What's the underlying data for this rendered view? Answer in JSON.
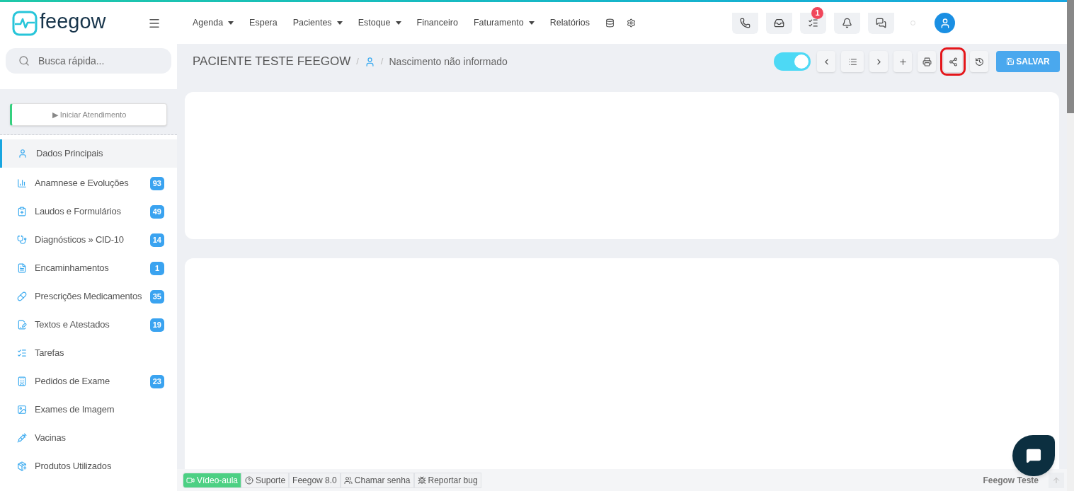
{
  "logo": {
    "text": "feegow"
  },
  "nav": [
    {
      "label": "Agenda",
      "dropdown": true
    },
    {
      "label": "Espera",
      "dropdown": false
    },
    {
      "label": "Pacientes",
      "dropdown": true
    },
    {
      "label": "Estoque",
      "dropdown": true
    },
    {
      "label": "Financeiro",
      "dropdown": false
    },
    {
      "label": "Faturamento",
      "dropdown": true
    },
    {
      "label": "Relatórios",
      "dropdown": false
    }
  ],
  "header_buttons": [
    {
      "kind": "phone"
    },
    {
      "kind": "inbox"
    },
    {
      "kind": "tasks",
      "badge": "1"
    },
    {
      "kind": "bell"
    },
    {
      "kind": "chat"
    }
  ],
  "search": {
    "placeholder": "Busca rápida..."
  },
  "start_button": {
    "label": "▶ Iniciar Atendimento"
  },
  "sidebar": {
    "items": [
      {
        "label": "Dados Principais",
        "selected": true
      },
      {
        "label": "Anamnese e Evoluções",
        "badge": "93",
        "selected": false
      },
      {
        "label": "Laudos e Formulários",
        "badge": "49",
        "selected": false
      },
      {
        "label": "Diagnósticos » CID-10",
        "badge": "14",
        "selected": false
      },
      {
        "label": "Encaminhamentos",
        "badge": "1",
        "selected": false
      },
      {
        "label": "Prescrições Medicamentos",
        "badge": "35",
        "selected": false
      },
      {
        "label": "Textos e Atestados",
        "badge": "19",
        "selected": false
      },
      {
        "label": "Tarefas",
        "selected": false
      },
      {
        "label": "Pedidos de Exame",
        "badge": "23",
        "selected": false
      },
      {
        "label": "Exames de Imagem",
        "selected": false
      },
      {
        "label": "Vacinas",
        "selected": false
      },
      {
        "label": "Produtos Utilizados",
        "selected": false
      }
    ]
  },
  "patient": {
    "name": "PACIENTE TESTE FEEGOW",
    "separators": [
      "/",
      "/"
    ],
    "birth": "Nascimento não informado"
  },
  "toolbar": {
    "toggle_on": true,
    "buttons": [
      {
        "kind": "prev",
        "highlighted": false
      },
      {
        "kind": "list",
        "highlighted": false
      },
      {
        "kind": "next",
        "highlighted": false
      },
      {
        "kind": "add",
        "highlighted": false
      },
      {
        "kind": "print",
        "highlighted": false
      },
      {
        "kind": "share",
        "highlighted": true
      },
      {
        "kind": "history",
        "highlighted": false
      }
    ],
    "save": "SALVAR"
  },
  "footer": {
    "items": [
      {
        "label": "Vídeo-aula",
        "kind": "video"
      },
      {
        "label": "Suporte",
        "kind": "help"
      },
      {
        "label": "Feegow 8.0",
        "kind": "text"
      },
      {
        "label": "Chamar senha",
        "kind": "users"
      },
      {
        "label": "Reportar bug",
        "kind": "bug"
      }
    ],
    "user": "Feegow Teste"
  }
}
